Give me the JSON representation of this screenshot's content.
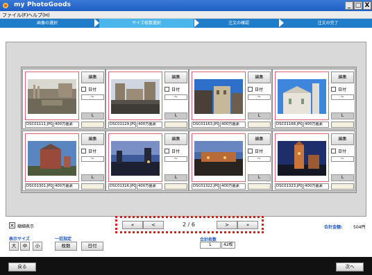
{
  "window": {
    "title": "my PhotoGoods",
    "minimize": "_",
    "maximize": "□",
    "close": "X"
  },
  "menu": [
    {
      "label": "ファイル(F)"
    },
    {
      "label": "ヘルプ(H)"
    }
  ],
  "steps": [
    {
      "label": "画像の選択",
      "active": false
    },
    {
      "label": "サイズ枚数選択",
      "active": true
    },
    {
      "label": "注文の確認",
      "active": false
    },
    {
      "label": "注文の完了",
      "active": false
    }
  ],
  "card_labels": {
    "edit": "編集",
    "date": "日付",
    "date_value": "~",
    "size": "L"
  },
  "photos": [
    {
      "filename": "DSC01111.JPG",
      "resolution": "400万画素"
    },
    {
      "filename": "DSC01129.JPG",
      "resolution": "400万画素"
    },
    {
      "filename": "DSC01163.JPG",
      "resolution": "400万画素"
    },
    {
      "filename": "DSC01168.JPG",
      "resolution": "400万画素"
    },
    {
      "filename": "DSC01301.JPG",
      "resolution": "400万画素"
    },
    {
      "filename": "DSC01316.JPG",
      "resolution": "400万画素"
    },
    {
      "filename": "DSC01322.JPG",
      "resolution": "400万画素"
    },
    {
      "filename": "DSC01323.JPG",
      "resolution": "400万画素"
    }
  ],
  "pager": {
    "first": "«",
    "prev": "<",
    "indicator": "2 / 6",
    "next": ">",
    "last": "»"
  },
  "options": {
    "thumbnail_display": "縮細表示",
    "display_size_label": "表示サイズ",
    "size_large": "大",
    "size_medium": "中",
    "size_small": "小",
    "bulk_label": "一括指定",
    "bulk_count": "枚数",
    "bulk_date": "日付"
  },
  "totals": {
    "count_label": "合計枚数",
    "count_size": "L",
    "count_value": "42枚",
    "amount_label": "合計金額:",
    "amount_value": "504円"
  },
  "footer": {
    "back": "戻る",
    "next": "次へ"
  },
  "colors": {
    "titlebar": "#1f5fc4",
    "steps_bar": "#1e7cc8",
    "step_active": "#4bb6ec",
    "accent_label": "#1a55c4",
    "pager_outline": "#e01818"
  }
}
